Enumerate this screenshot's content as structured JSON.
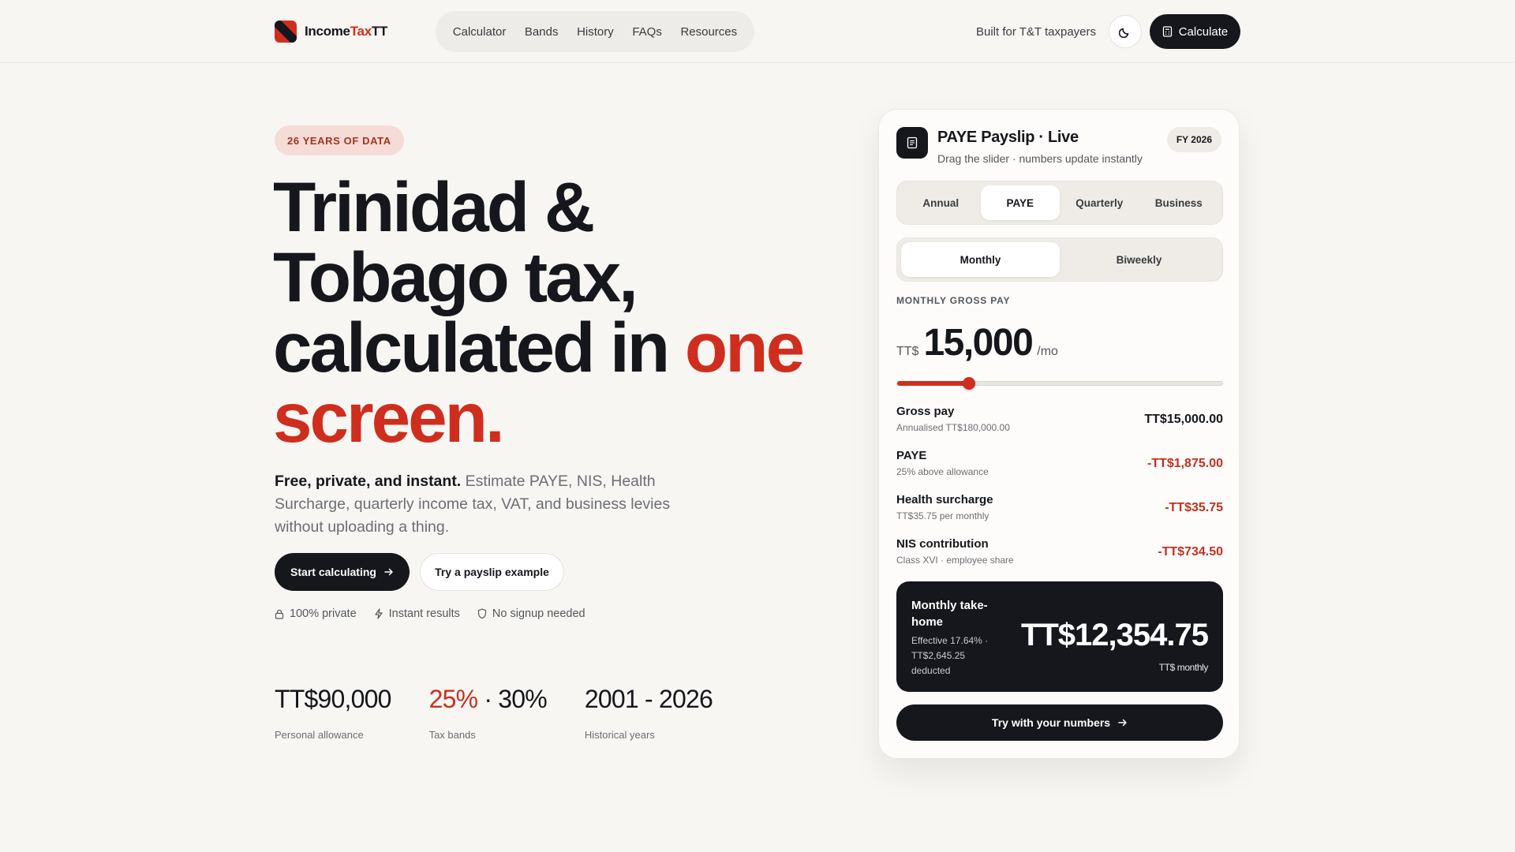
{
  "header": {
    "brand_pre": "Income",
    "brand_accent": "Tax",
    "brand_post": "TT",
    "nav": [
      "Calculator",
      "Bands",
      "History",
      "FAQs",
      "Resources"
    ],
    "tagline": "Built for T&T taxpayers",
    "theme_icon": "moon-icon",
    "cta_label": "Calculate"
  },
  "hero": {
    "badge": "26 YEARS OF DATA",
    "title_line1": "Trinidad &",
    "title_line2": "Tobago tax,",
    "title_line3a": "calculated in ",
    "title_line3b": "one",
    "title_line4": "screen.",
    "lead_strong": "Free, private, and instant.",
    "lead_rest": " Estimate PAYE, NIS, Health Surcharge, quarterly income tax, VAT, and business levies without uploading a thing.",
    "primary_cta": "Start calculating",
    "secondary_cta": "Try a payslip example",
    "features": [
      "100% private",
      "Instant results",
      "No signup needed"
    ],
    "stats": {
      "allowance_value": "TT$90,000",
      "allowance_label": "Personal allowance",
      "bands_value_red": "25%",
      "bands_value_rest": " · 30%",
      "bands_label": "Tax bands",
      "years_value": "2001 - 2026",
      "years_label": "Historical years"
    }
  },
  "card": {
    "title": "PAYE Payslip · Live",
    "subtitle": "Drag the slider · numbers update instantly",
    "fy": "FY 2026",
    "tabs": [
      "Annual",
      "PAYE",
      "Quarterly",
      "Business"
    ],
    "active_tab": 1,
    "frequency": [
      "Monthly",
      "Biweekly"
    ],
    "active_frequency": 0,
    "gross_label": "MONTHLY GROSS PAY",
    "currency": "TT$",
    "gross_value": "15,000",
    "gross_unit": "/mo",
    "slider_fraction": 0.22,
    "rows": [
      {
        "label": "Gross pay",
        "sub": "Annualised TT$180,000.00",
        "value": "TT$15,000.00",
        "negative": false
      },
      {
        "label": "PAYE",
        "sub": "25% above allowance",
        "value": "-TT$1,875.00",
        "negative": true
      },
      {
        "label": "Health surcharge",
        "sub": "TT$35.75 per monthly",
        "value": "-TT$35.75",
        "negative": true
      },
      {
        "label": "NIS contribution",
        "sub": "Class XVI · employee share",
        "value": "-TT$734.50",
        "negative": true
      }
    ],
    "takehome_label": "Monthly take-home",
    "takehome_sub": "Effective 17.64% · TT$2,645.25 deducted",
    "takehome_value": "TT$12,354.75",
    "takehome_unit": "TT$ monthly",
    "cta": "Try with your numbers"
  },
  "colors": {
    "accent": "#cf2e1e",
    "dark": "#15171c",
    "background": "#f7f6f3"
  }
}
